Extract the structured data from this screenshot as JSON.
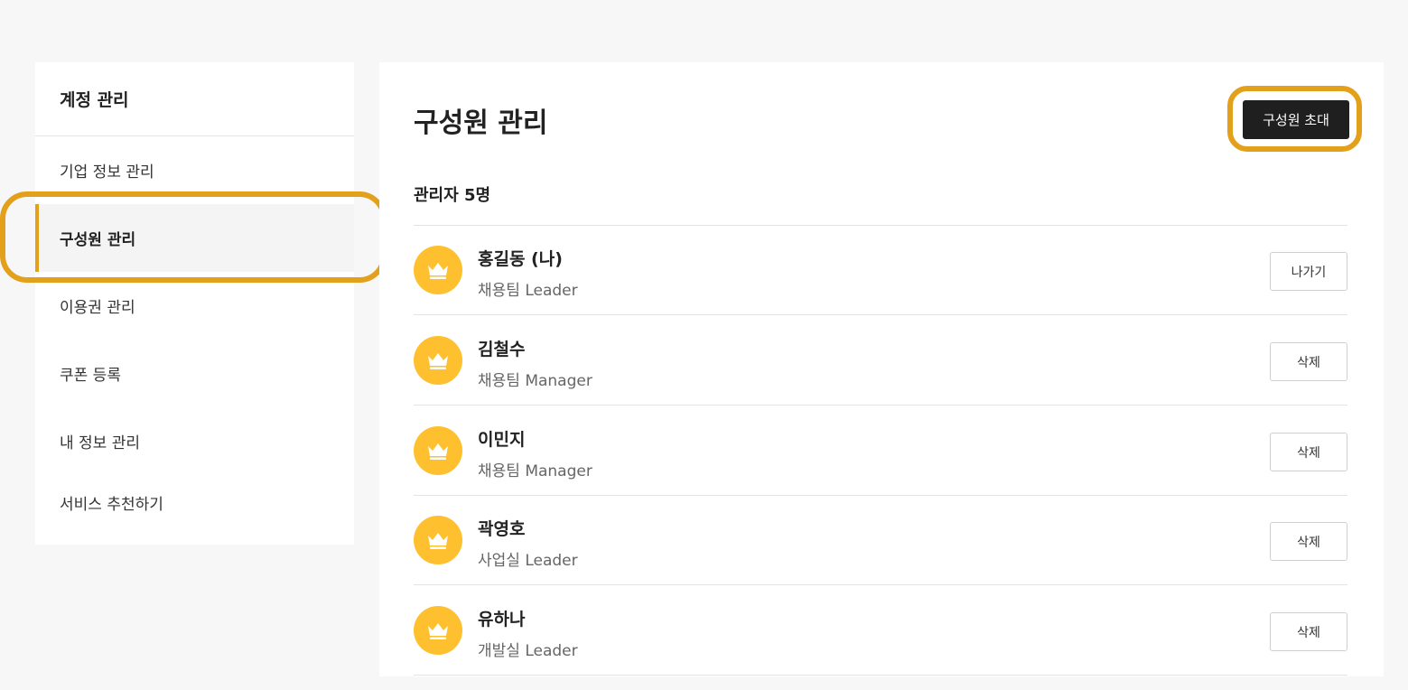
{
  "sidebar": {
    "title": "계정 관리",
    "items": [
      {
        "label": "기업 정보 관리",
        "active": false
      },
      {
        "label": "구성원 관리",
        "active": true
      },
      {
        "label": "이용권 관리",
        "active": false
      },
      {
        "label": "쿠폰 등록",
        "active": false
      },
      {
        "label": "내 정보 관리",
        "active": false
      },
      {
        "label": "서비스 추천하기",
        "active": false
      }
    ]
  },
  "main": {
    "title": "구성원 관리",
    "invite_label": "구성원 초대",
    "count_label": "관리자 5명",
    "members": [
      {
        "name": "홍길동 (나)",
        "role": "채용팀 Leader",
        "action": "나가기",
        "avatar_icon": "crown-icon"
      },
      {
        "name": "김철수",
        "role": "채용팀 Manager",
        "action": "삭제",
        "avatar_icon": "crown-icon"
      },
      {
        "name": "이민지",
        "role": "채용팀 Manager",
        "action": "삭제",
        "avatar_icon": "crown-icon"
      },
      {
        "name": "곽영호",
        "role": "사업실 Leader",
        "action": "삭제",
        "avatar_icon": "crown-icon"
      },
      {
        "name": "유하나",
        "role": "개발실 Leader",
        "action": "삭제",
        "avatar_icon": "crown-icon"
      }
    ]
  },
  "colors": {
    "accent": "#e3a01b",
    "avatar_bg": "#fec02f",
    "primary_button": "#1f1f1f",
    "page_bg": "#f7f7f7"
  }
}
